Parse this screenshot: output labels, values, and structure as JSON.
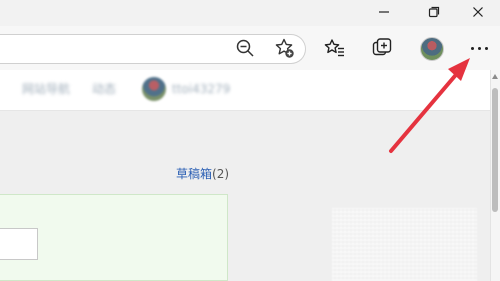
{
  "browser": {
    "window_controls": {
      "minimize_icon": "minimize-icon",
      "maximize_icon": "restore-icon",
      "close_icon": "close-icon"
    },
    "toolbar": {
      "zoom_icon": "zoom-out-icon",
      "add_favorite_icon": "add-favorite-icon",
      "favorites_icon": "favorites-icon",
      "collections_icon": "collections-icon",
      "profile_icon": "profile-avatar",
      "settings_icon": "more-settings-icon"
    }
  },
  "page": {
    "nav_blurred_items": [
      "网站导航",
      "动态",
      "ttoi43279"
    ],
    "drafts_link": {
      "label": "草稿箱",
      "count": "(2)"
    }
  },
  "annotation": {
    "arrow_color": "#e5333f"
  }
}
